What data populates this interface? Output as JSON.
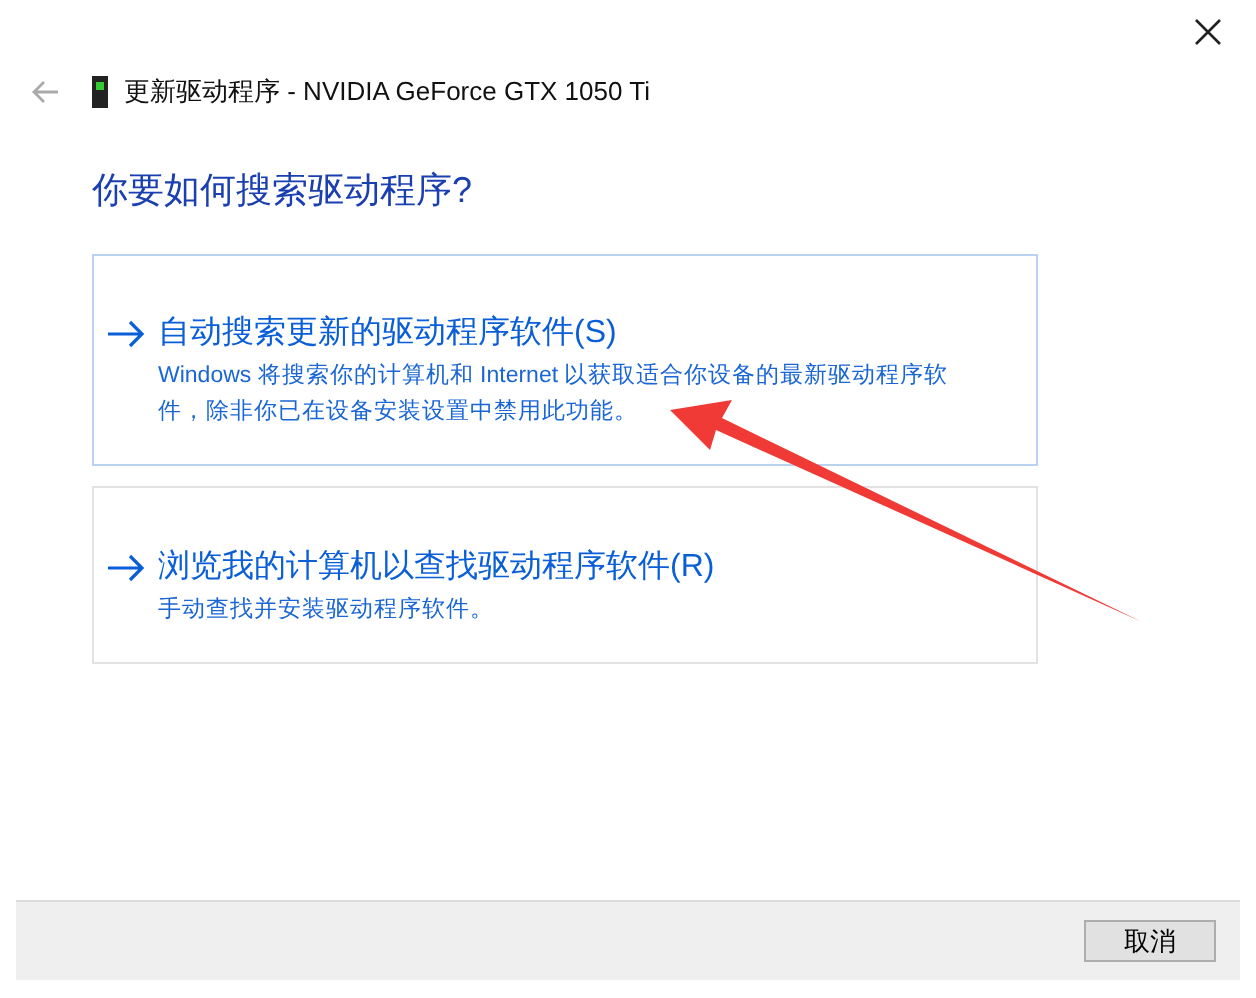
{
  "window": {
    "title": "更新驱动程序 - NVIDIA GeForce GTX 1050 Ti"
  },
  "heading": "你要如何搜索驱动程序?",
  "options": [
    {
      "title": "自动搜索更新的驱动程序软件(S)",
      "description": "Windows 将搜索你的计算机和 Internet 以获取适合你设备的最新驱动程序软件，除非你已在设备安装设置中禁用此功能。",
      "selected": true
    },
    {
      "title": "浏览我的计算机以查找驱动程序软件(R)",
      "description": "手动查找并安装驱动程序软件。",
      "selected": false
    }
  ],
  "buttons": [
    "取消"
  ]
}
